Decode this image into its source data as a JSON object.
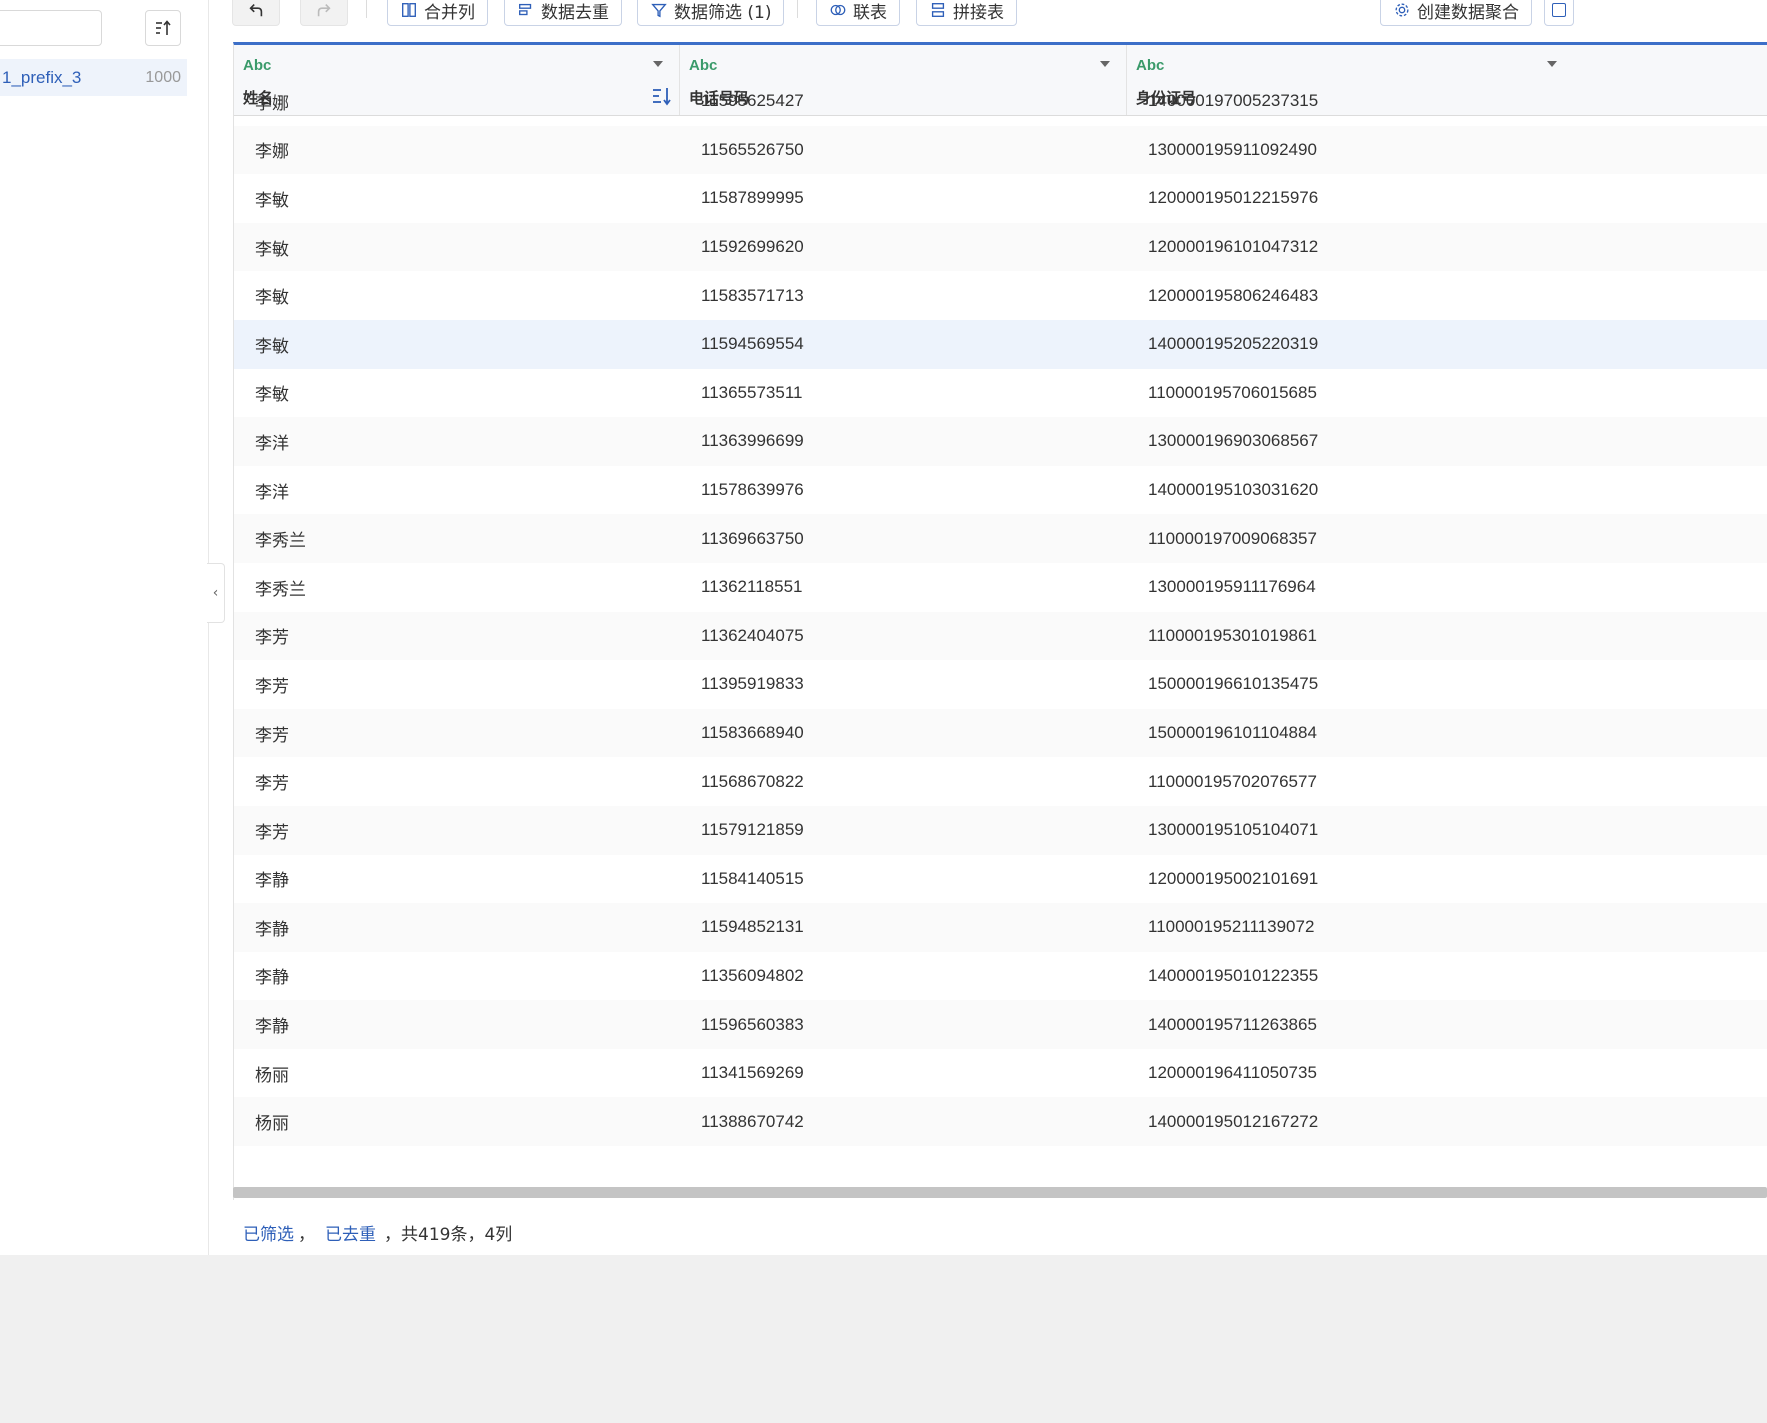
{
  "left_panel": {
    "search_value": "",
    "item": {
      "name": "1_prefix_3",
      "count": "1000"
    }
  },
  "toolbar": {
    "merge_columns": "合并列",
    "dedupe": "数据去重",
    "filter": "数据筛选 (1)",
    "join": "联表",
    "concat": "拼接表",
    "create_aggregate": "创建数据聚合"
  },
  "columns": [
    {
      "type": "Abc",
      "name": "姓名"
    },
    {
      "type": "Abc",
      "name": "电话号码"
    },
    {
      "type": "Abc",
      "name": "身份证号"
    }
  ],
  "rows": [
    [
      "李娜",
      "11595625427",
      "140000197005237315"
    ],
    [
      "李娜",
      "11565526750",
      "130000195911092490"
    ],
    [
      "李敏",
      "11587899995",
      "120000195012215976"
    ],
    [
      "李敏",
      "11592699620",
      "120000196101047312"
    ],
    [
      "李敏",
      "11583571713",
      "120000195806246483"
    ],
    [
      "李敏",
      "11594569554",
      "140000195205220319"
    ],
    [
      "李敏",
      "11365573511",
      "110000195706015685"
    ],
    [
      "李洋",
      "11363996699",
      "130000196903068567"
    ],
    [
      "李洋",
      "11578639976",
      "140000195103031620"
    ],
    [
      "李秀兰",
      "11369663750",
      "110000197009068357"
    ],
    [
      "李秀兰",
      "11362118551",
      "130000195911176964"
    ],
    [
      "李芳",
      "11362404075",
      "110000195301019861"
    ],
    [
      "李芳",
      "11395919833",
      "150000196610135475"
    ],
    [
      "李芳",
      "11583668940",
      "150000196101104884"
    ],
    [
      "李芳",
      "11568670822",
      "110000195702076577"
    ],
    [
      "李芳",
      "11579121859",
      "130000195105104071"
    ],
    [
      "李静",
      "11584140515",
      "120000195002101691"
    ],
    [
      "李静",
      "11594852131",
      "110000195211139072"
    ],
    [
      "李静",
      "11356094802",
      "140000195010122355"
    ],
    [
      "李静",
      "11596560383",
      "140000195711263865"
    ],
    [
      "杨丽",
      "11341569269",
      "120000196411050735"
    ],
    [
      "杨丽",
      "11388670742",
      "140000195012167272"
    ]
  ],
  "footer": {
    "filtered": "已筛选",
    "sep1": "，",
    "deduped": "已去重",
    "summary": "，共419条，4列"
  },
  "icons": {
    "undo": "undo-arrow-icon",
    "redo": "redo-arrow-icon",
    "sort": "sort-ascending-icon"
  },
  "colors": {
    "accent": "#3c6fc8",
    "type_label": "#3a9a6a",
    "link": "#2e5fb8",
    "selected_row": "#edf3fc"
  }
}
